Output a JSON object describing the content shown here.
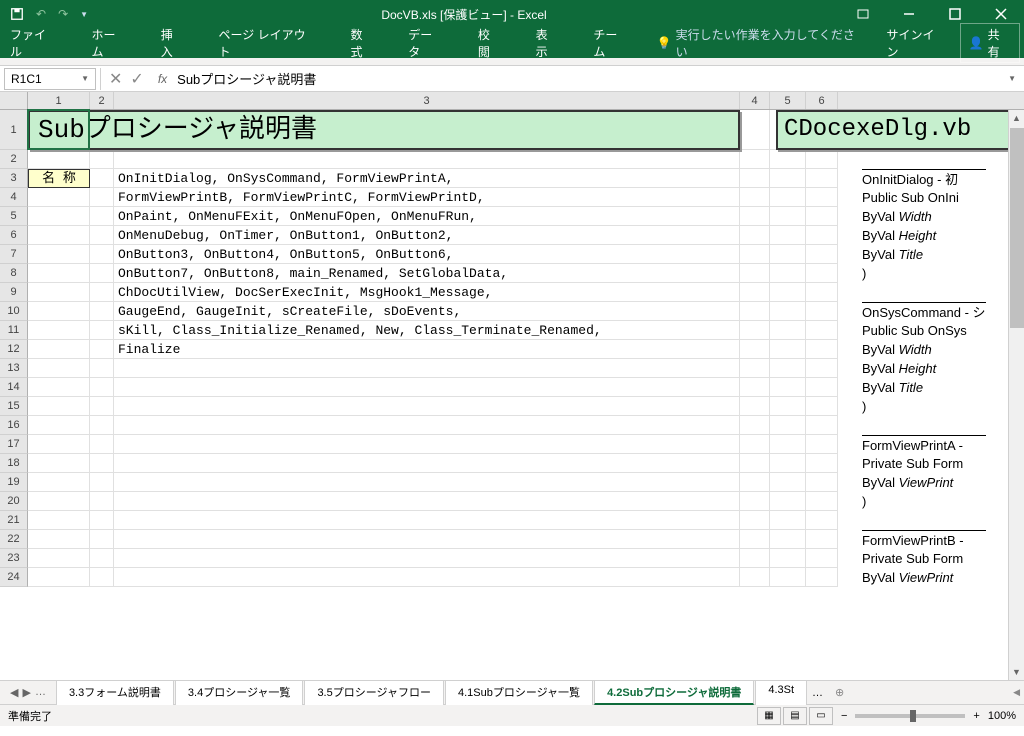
{
  "titlebar": {
    "title": "DocVB.xls  [保護ビュー] - Excel"
  },
  "ribbon": {
    "tabs": [
      "ファイル",
      "ホーム",
      "挿入",
      "ページ レイアウト",
      "数式",
      "データ",
      "校閲",
      "表示",
      "チーム"
    ],
    "tell_me": "実行したい作業を入力してください",
    "signin": "サインイン",
    "share": "共有"
  },
  "namebox": "R1C1",
  "formula": "Subプロシージャ説明書",
  "columns": [
    "1",
    "2",
    "3",
    "4",
    "5",
    "6"
  ],
  "rows": [
    "1",
    "2",
    "3",
    "4",
    "5",
    "6",
    "7",
    "8",
    "9",
    "10",
    "11",
    "12",
    "13",
    "14",
    "15",
    "16",
    "17",
    "18",
    "19",
    "20",
    "21",
    "22",
    "23",
    "24"
  ],
  "main_title": "Subプロシージャ説明書",
  "file_title": "CDocexeDlg.vb",
  "name_label": "名 称",
  "content_lines": [
    "OnInitDialog, OnSysCommand, FormViewPrintA,",
    "FormViewPrintB, FormViewPrintC, FormViewPrintD,",
    "OnPaint, OnMenuFExit, OnMenuFOpen, OnMenuFRun,",
    "OnMenuDebug, OnTimer, OnButton1, OnButton2,",
    "OnButton3, OnButton4, OnButton5, OnButton6,",
    "OnButton7, OnButton8, main_Renamed, SetGlobalData,",
    "ChDocUtilView, DocSerExecInit, MsgHook1_Message,",
    "GaugeEnd, GaugeInit, sCreateFile, sDoEvents,",
    "sKill, Class_Initialize_Renamed, New, Class_Terminate_Renamed,",
    "Finalize"
  ],
  "right_blocks": [
    {
      "lines": [
        "OnInitDialog - 初",
        "Public Sub OnIni",
        "  ByVal Width  ",
        "  ByVal Height ",
        "  ByVal Title  ",
        ")"
      ]
    },
    {
      "lines": [
        "OnSysCommand - シ",
        "Public Sub OnSys",
        "  ByVal Width  ",
        "  ByVal Height ",
        "  ByVal Title  ",
        ")"
      ]
    },
    {
      "lines": [
        "FormViewPrintA -",
        "Private Sub Form",
        "  ByVal ViewPrint",
        ")"
      ]
    },
    {
      "lines": [
        "FormViewPrintB -",
        "Private Sub Form",
        "  ByVal ViewPrint"
      ]
    }
  ],
  "sheet_tabs": [
    "3.3フォーム説明書",
    "3.4プロシージャ一覧",
    "3.5プロシージャフロー",
    "4.1Subプロシージャ一覧",
    "4.2Subプロシージャ説明書",
    "4.3St"
  ],
  "active_tab": 4,
  "status": "準備完了",
  "zoom": "100%"
}
